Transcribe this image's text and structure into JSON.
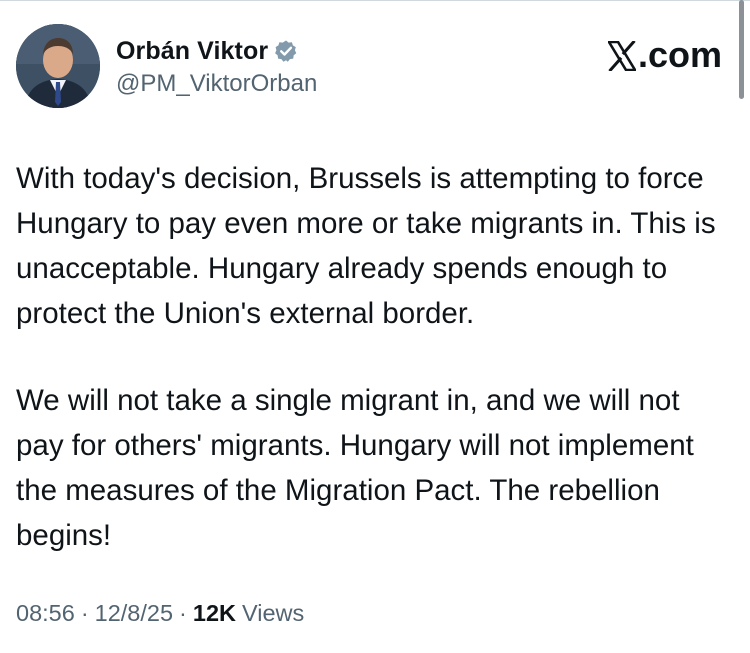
{
  "author": {
    "display_name": "Orbán Viktor",
    "handle": "@PM_ViktorOrban",
    "verified_icon": "verified-badge-icon",
    "verified_color": "#829aab"
  },
  "brand": {
    "label": ".com",
    "icon": "x-logo-icon"
  },
  "tweet": {
    "paragraphs": [
      "With today's decision, Brussels is attempting to force Hungary to pay even more or take migrants in. This is unacceptable. Hungary already spends enough to protect the Union's external border.",
      "We will not take a single migrant in, and we will not pay for others' migrants. Hungary will not implement the measures of the Migration Pact. The rebellion begins!"
    ]
  },
  "meta": {
    "time": "08:56",
    "separator": "·",
    "date": "12/8/25",
    "views_count": "12K",
    "views_label": "Views"
  },
  "colors": {
    "text_primary": "#0f1419",
    "text_secondary": "#536471",
    "background": "#ffffff"
  }
}
